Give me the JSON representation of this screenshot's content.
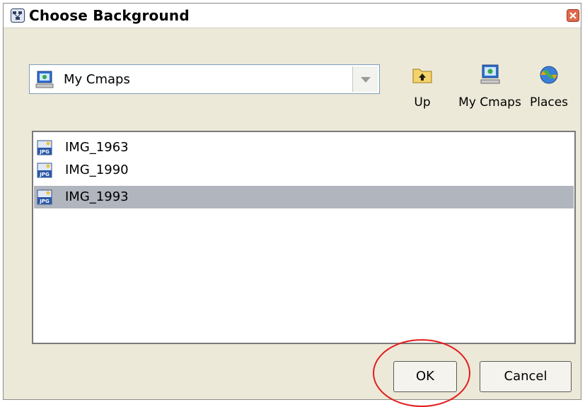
{
  "window": {
    "title": "Choose Background",
    "close_icon": "close-icon"
  },
  "location": {
    "selected": "My Cmaps",
    "icon": "my-cmaps-icon"
  },
  "toolbar": {
    "up_label": "Up",
    "mycmaps_label": "My Cmaps",
    "places_label": "Places"
  },
  "files": [
    {
      "name": "IMG_1963",
      "icon": "jpg-file-icon",
      "selected": false
    },
    {
      "name": "IMG_1990",
      "icon": "jpg-file-icon",
      "selected": false
    },
    {
      "name": "IMG_1993",
      "icon": "jpg-file-icon",
      "selected": true
    }
  ],
  "buttons": {
    "ok_label": "OK",
    "cancel_label": "Cancel"
  },
  "annotation": {
    "highlight_color": "#e41b1b",
    "highlights": "ok-button"
  }
}
